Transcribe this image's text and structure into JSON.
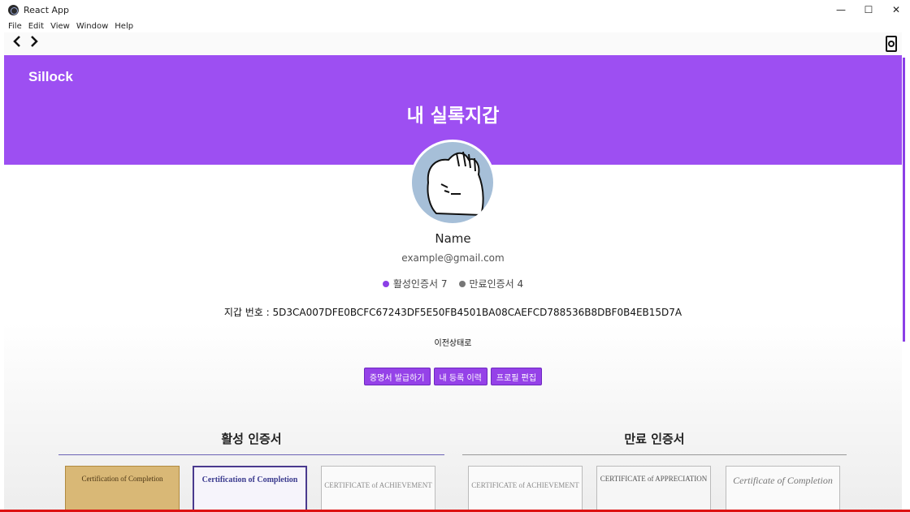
{
  "window": {
    "title": "React App",
    "controls": {
      "minimize": "—",
      "maximize": "☐",
      "close": "✕"
    }
  },
  "menu": [
    "File",
    "Edit",
    "View",
    "Window",
    "Help"
  ],
  "nav": {
    "back": "‹",
    "forward": "›"
  },
  "header": {
    "brand": "Sillock",
    "title": "내 실록지갑"
  },
  "profile": {
    "name": "Name",
    "email": "example@gmail.com",
    "active_label": "활성인증서 7",
    "expired_label": "만료인증서 4",
    "wallet_number": "지갑 번호 : 5D3CA007DFE0BCFC67243DF5E50FB4501BA08CAEFCD788536B8DBF0B4EB15D7A",
    "prev_state": "이전상태로"
  },
  "actions": {
    "issue_certificate": "증명서 발급하기",
    "my_history": "내 등록 이력",
    "edit_profile": "프로필 편집"
  },
  "sections": {
    "active_title": "활성 인증서",
    "expired_title": "만료 인증서"
  },
  "certificates": {
    "active": [
      {
        "title": "Certification of Completion"
      },
      {
        "title": "Certification of Completion"
      },
      {
        "title": "CERTIFICATE of ACHIEVEMENT"
      }
    ],
    "expired": [
      {
        "title": "CERTIFICATE of ACHIEVEMENT"
      },
      {
        "title": "CERTIFICATE of APPRECIATION"
      },
      {
        "title": "Certificate of Completion"
      }
    ]
  },
  "colors": {
    "brand_purple": "#9d4ff2",
    "button_purple": "#9542e8",
    "active_dot": "#8b3fe6",
    "expired_dot": "#777777",
    "section_line_active": "#6b63b5",
    "section_line_expired": "#999999"
  },
  "icons": {
    "profile": "user-circle-icon",
    "back": "chevron-left-icon",
    "forward": "chevron-right-icon"
  }
}
